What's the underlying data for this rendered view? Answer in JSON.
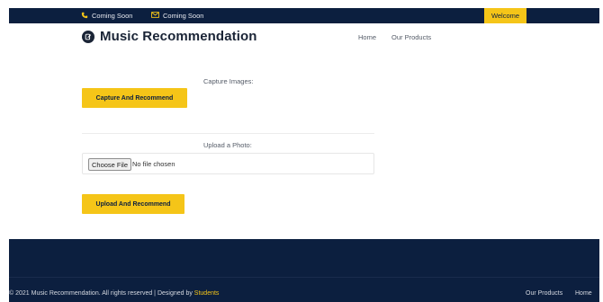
{
  "topbar": {
    "contact_1": {
      "icon": "phone-icon",
      "text": "Coming Soon"
    },
    "contact_2": {
      "icon": "mail-icon",
      "text": "Coming Soon"
    },
    "welcome": "Welcome"
  },
  "header": {
    "brand_title": "Music Recommendation",
    "logo_icon": "music-logo-icon",
    "nav": [
      "Home",
      "Our Products"
    ]
  },
  "main": {
    "capture_label": "Capture Images:",
    "capture_button": "Capture And Recommend",
    "upload_label": "Upload a Photo:",
    "file_input": {
      "button": "Choose File",
      "status": "No file chosen"
    },
    "upload_button": "Upload And Recommend"
  },
  "footer": {
    "copyright": "© 2021 Music Recommendation. All rights reserved | Designed by ",
    "designer": "Students",
    "links": [
      "Our Products",
      "Home"
    ]
  },
  "colors": {
    "navy": "#0c1f3f",
    "accent": "#f5c518",
    "text_muted": "#555c68"
  }
}
